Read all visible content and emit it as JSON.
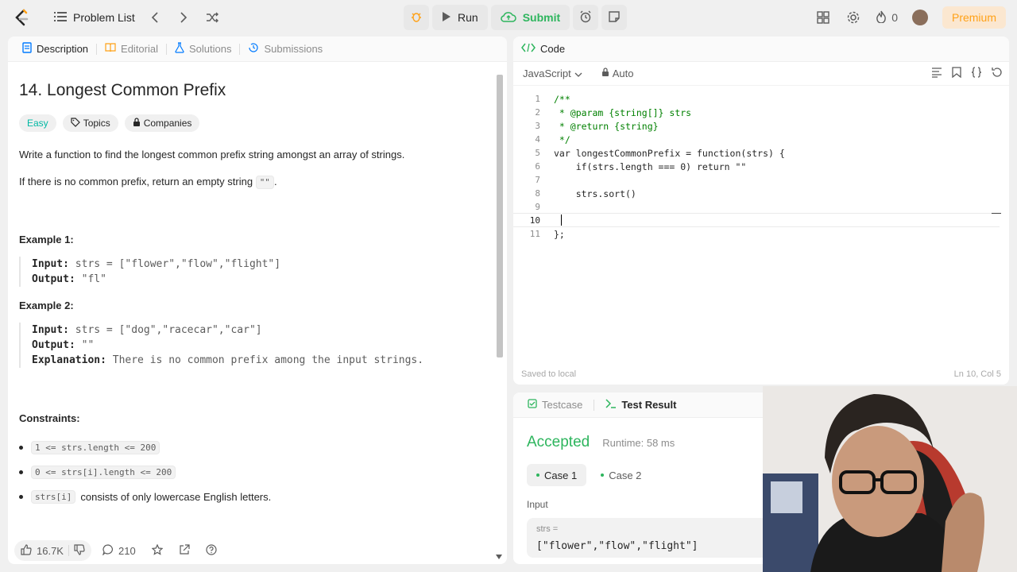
{
  "topbar": {
    "problem_list_label": "Problem List",
    "run_label": "Run",
    "submit_label": "Submit",
    "flame_count": "0",
    "premium_label": "Premium"
  },
  "left": {
    "tabs": [
      {
        "label": "Description"
      },
      {
        "label": "Editorial"
      },
      {
        "label": "Solutions"
      },
      {
        "label": "Submissions"
      }
    ],
    "title": "14. Longest Common Prefix",
    "tags": {
      "difficulty": "Easy",
      "topics": "Topics",
      "companies": "Companies"
    },
    "paragraph1": "Write a function to find the longest common prefix string amongst an array of strings.",
    "paragraph2_before": "If there is no common prefix, return an empty string ",
    "paragraph2_code": "\"\"",
    "paragraph2_after": ".",
    "example1": {
      "heading": "Example 1:",
      "input_label": "Input:",
      "input_value": "strs = [\"flower\",\"flow\",\"flight\"]",
      "output_label": "Output:",
      "output_value": "\"fl\""
    },
    "example2": {
      "heading": "Example 2:",
      "input_label": "Input:",
      "input_value": "strs = [\"dog\",\"racecar\",\"car\"]",
      "output_label": "Output:",
      "output_value": "\"\"",
      "explanation_label": "Explanation:",
      "explanation_value": "There is no common prefix among the input strings."
    },
    "constraints_heading": "Constraints:",
    "constraints": [
      {
        "code": "1 <= strs.length <= 200",
        "text": ""
      },
      {
        "code": "0 <= strs[i].length <= 200",
        "text": ""
      },
      {
        "code": "strs[i]",
        "text": "consists of only lowercase English letters."
      }
    ],
    "footer": {
      "likes": "16.7K",
      "comments": "210"
    }
  },
  "code": {
    "tab_label": "Code",
    "language": "JavaScript",
    "auto_label": "Auto",
    "lines": [
      "/**",
      " * @param {string[]} strs",
      " * @return {string}",
      " */",
      "var longestCommonPrefix = function(strs) {",
      "    if(strs.length === 0) return \"\"",
      "",
      "    strs.sort()",
      "",
      "",
      "};"
    ],
    "saved_status": "Saved to local",
    "cursor_position": "Ln 10, Col 5"
  },
  "result": {
    "testcase_tab": "Testcase",
    "result_tab": "Test Result",
    "status": "Accepted",
    "runtime": "Runtime: 58 ms",
    "cases": [
      {
        "label": "Case 1"
      },
      {
        "label": "Case 2"
      }
    ],
    "input_label": "Input",
    "input_name": "strs =",
    "input_value": "[\"flower\",\"flow\",\"flight\"]"
  },
  "colors": {
    "accent_green": "#2db55d",
    "easy_teal": "#00b8a3",
    "premium_orange": "#ffa116"
  }
}
